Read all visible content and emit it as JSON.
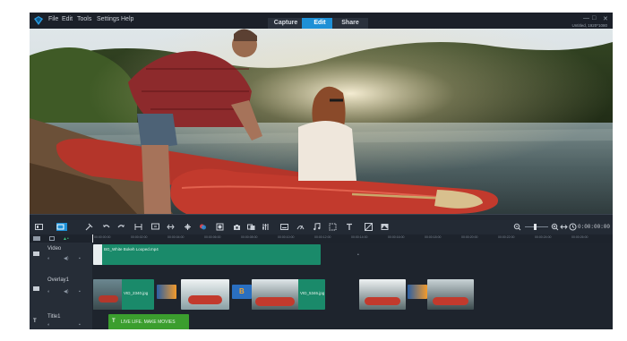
{
  "menu": {
    "items": [
      "File",
      "Edit",
      "Tools",
      "Settings",
      "Help"
    ]
  },
  "workspace_tabs": [
    {
      "label": "Capture",
      "active": false
    },
    {
      "label": "Edit",
      "active": true
    },
    {
      "label": "Share",
      "active": false
    }
  ],
  "document": {
    "name": "Untitled, 1920*1080"
  },
  "timecode": "0:00:00:00",
  "ruler": {
    "ticks": [
      "00:00:00:00",
      "00:00:02:00",
      "00:00:04:00",
      "00:00:06:00",
      "00:00:08:00",
      "00:00:10:00",
      "00:00:12:00",
      "00:00:14:00",
      "00:00:16:00",
      "00:00:18:00",
      "00:00:20:00",
      "00:00:22:00",
      "00:00:24:00",
      "00:00:26:00"
    ]
  },
  "tracks": {
    "video": {
      "name": "Video",
      "clip_label": "BG_White Bokeh Looped.mp4"
    },
    "overlay": {
      "name": "Overlay1",
      "clips": [
        "VID_2340.jpg",
        "VID_5346.jpg"
      ]
    },
    "title": {
      "name": "Title1",
      "clip_label": "LIVE LIFE. MAKE MOVIES"
    }
  },
  "colors": {
    "accent": "#1e90d6",
    "clip_green": "#1a8a6a",
    "title_green": "#3b9e2e"
  }
}
